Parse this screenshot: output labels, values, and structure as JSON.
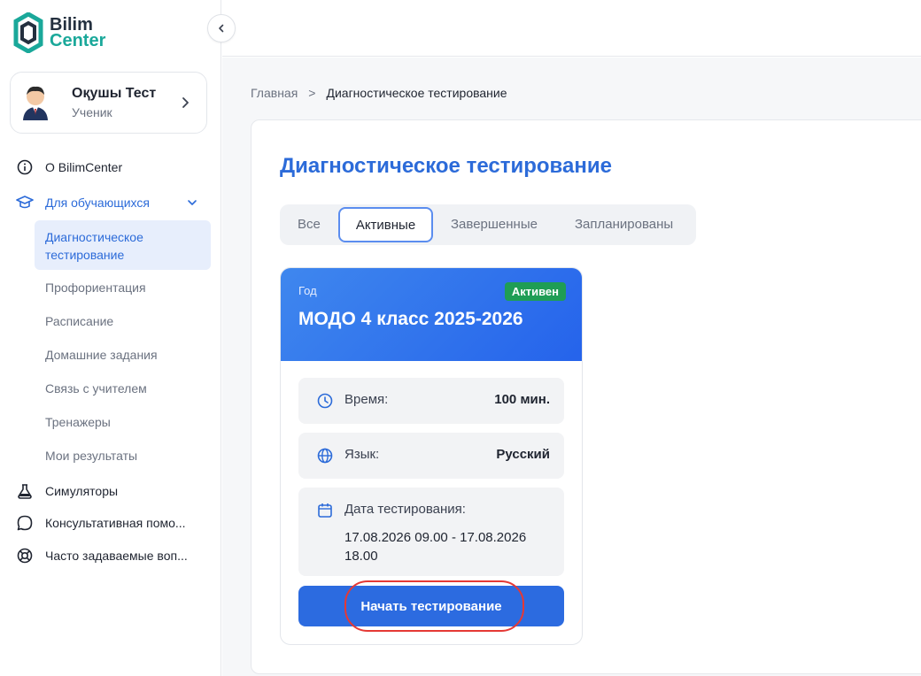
{
  "logo": {
    "line1": "Bilim",
    "line2": "Center"
  },
  "profile": {
    "name": "Оқушы Тест",
    "role": "Ученик"
  },
  "nav": {
    "about": "О BilimCenter",
    "students": "Для обучающихся",
    "sub_active": "Диагностическое тестирование",
    "sub_items": [
      "Профориентация",
      "Расписание",
      "Домашние задания",
      "Связь с учителем",
      "Тренажеры",
      "Мои результаты"
    ],
    "simulators": "Симуляторы",
    "consult": "Консультативная помо...",
    "faq": "Часто задаваемые воп..."
  },
  "breadcrumb": {
    "home": "Главная",
    "separator": ">",
    "current": "Диагностическое тестирование"
  },
  "page": {
    "title": "Диагностическое тестирование"
  },
  "tabs": [
    "Все",
    "Активные",
    "Завершенные",
    "Запланированы"
  ],
  "card": {
    "year_label": "Год",
    "status": "Активен",
    "title": "МОДО 4 класс 2025-2026",
    "time_label": "Время:",
    "time_value": "100 мин.",
    "lang_label": "Язык:",
    "lang_value": "Русский",
    "date_label": "Дата тестирования:",
    "date_value": "17.08.2026 09.00 - 17.08.2026 18.00",
    "start_button": "Начать тестирование"
  },
  "colors": {
    "accent": "#2c6bd9",
    "brand_teal": "#1aa89a",
    "status_green": "#1f9d55",
    "highlight": "#e53935"
  }
}
